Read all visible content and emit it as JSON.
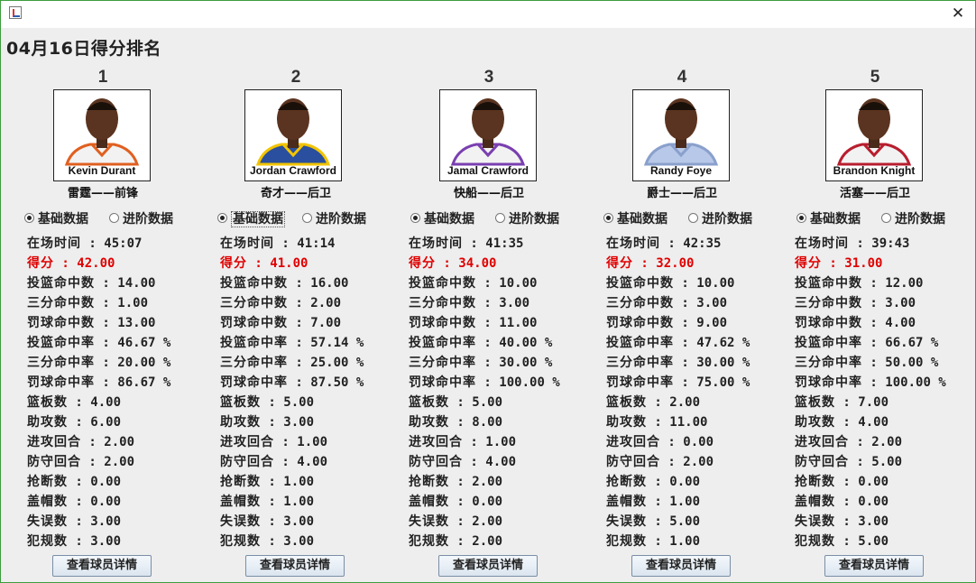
{
  "window": {
    "title": "",
    "close_glyph": "✕",
    "icon": "java-app-icon"
  },
  "page_title": "04月16日得分排名",
  "radio_labels": {
    "basic": "基础数据",
    "advanced": "进阶数据"
  },
  "detail_button_label": "查看球员详情",
  "colors": {
    "highlight": "#e00000",
    "background": "#eeeeee",
    "frame": "#3c9c3c"
  },
  "players": [
    {
      "rank": "1",
      "name": "Kevin Durant",
      "team_position": "雷霆——前锋",
      "jersey_color": "#f2f2f2",
      "trim_color": "#e06020",
      "stats": [
        {
          "label": "在场时间",
          "value": "45:07"
        },
        {
          "label": "得分",
          "value": "42.00"
        },
        {
          "label": "投篮命中数",
          "value": "14.00"
        },
        {
          "label": "三分命中数",
          "value": "1.00"
        },
        {
          "label": "罚球命中数",
          "value": "13.00"
        },
        {
          "label": "投篮命中率",
          "value": "46.67 %"
        },
        {
          "label": "三分命中率",
          "value": "20.00 %"
        },
        {
          "label": "罚球命中率",
          "value": "86.67 %"
        },
        {
          "label": "篮板数",
          "value": "4.00"
        },
        {
          "label": "助攻数",
          "value": "6.00"
        },
        {
          "label": "进攻回合",
          "value": "2.00"
        },
        {
          "label": "防守回合",
          "value": "2.00"
        },
        {
          "label": "抢断数",
          "value": "0.00"
        },
        {
          "label": "盖帽数",
          "value": "0.00"
        },
        {
          "label": "失误数",
          "value": "3.00"
        },
        {
          "label": "犯规数",
          "value": "3.00"
        }
      ]
    },
    {
      "rank": "2",
      "name": "Jordan Crawford",
      "team_position": "奇才——后卫",
      "jersey_color": "#2a4f9e",
      "trim_color": "#f2c400",
      "stats": [
        {
          "label": "在场时间",
          "value": "41:14"
        },
        {
          "label": "得分",
          "value": "41.00"
        },
        {
          "label": "投篮命中数",
          "value": "16.00"
        },
        {
          "label": "三分命中数",
          "value": "2.00"
        },
        {
          "label": "罚球命中数",
          "value": "7.00"
        },
        {
          "label": "投篮命中率",
          "value": "57.14 %"
        },
        {
          "label": "三分命中率",
          "value": "25.00 %"
        },
        {
          "label": "罚球命中率",
          "value": "87.50 %"
        },
        {
          "label": "篮板数",
          "value": "5.00"
        },
        {
          "label": "助攻数",
          "value": "3.00"
        },
        {
          "label": "进攻回合",
          "value": "1.00"
        },
        {
          "label": "防守回合",
          "value": "4.00"
        },
        {
          "label": "抢断数",
          "value": "1.00"
        },
        {
          "label": "盖帽数",
          "value": "1.00"
        },
        {
          "label": "失误数",
          "value": "3.00"
        },
        {
          "label": "犯规数",
          "value": "3.00"
        }
      ]
    },
    {
      "rank": "3",
      "name": "Jamal Crawford",
      "team_position": "快船——后卫",
      "jersey_color": "#f2f2f2",
      "trim_color": "#7a3fb0",
      "stats": [
        {
          "label": "在场时间",
          "value": "41:35"
        },
        {
          "label": "得分",
          "value": "34.00"
        },
        {
          "label": "投篮命中数",
          "value": "10.00"
        },
        {
          "label": "三分命中数",
          "value": "3.00"
        },
        {
          "label": "罚球命中数",
          "value": "11.00"
        },
        {
          "label": "投篮命中率",
          "value": "40.00 %"
        },
        {
          "label": "三分命中率",
          "value": "30.00 %"
        },
        {
          "label": "罚球命中率",
          "value": "100.00 %"
        },
        {
          "label": "篮板数",
          "value": "5.00"
        },
        {
          "label": "助攻数",
          "value": "8.00"
        },
        {
          "label": "进攻回合",
          "value": "1.00"
        },
        {
          "label": "防守回合",
          "value": "4.00"
        },
        {
          "label": "抢断数",
          "value": "2.00"
        },
        {
          "label": "盖帽数",
          "value": "0.00"
        },
        {
          "label": "失误数",
          "value": "2.00"
        },
        {
          "label": "犯规数",
          "value": "2.00"
        }
      ]
    },
    {
      "rank": "4",
      "name": "Randy Foye",
      "team_position": "爵士——后卫",
      "jersey_color": "#b8c8e8",
      "trim_color": "#8aa0cc",
      "stats": [
        {
          "label": "在场时间",
          "value": "42:35"
        },
        {
          "label": "得分",
          "value": "32.00"
        },
        {
          "label": "投篮命中数",
          "value": "10.00"
        },
        {
          "label": "三分命中数",
          "value": "3.00"
        },
        {
          "label": "罚球命中数",
          "value": "9.00"
        },
        {
          "label": "投篮命中率",
          "value": "47.62 %"
        },
        {
          "label": "三分命中率",
          "value": "30.00 %"
        },
        {
          "label": "罚球命中率",
          "value": "75.00 %"
        },
        {
          "label": "篮板数",
          "value": "2.00"
        },
        {
          "label": "助攻数",
          "value": "11.00"
        },
        {
          "label": "进攻回合",
          "value": "0.00"
        },
        {
          "label": "防守回合",
          "value": "2.00"
        },
        {
          "label": "抢断数",
          "value": "0.00"
        },
        {
          "label": "盖帽数",
          "value": "1.00"
        },
        {
          "label": "失误数",
          "value": "5.00"
        },
        {
          "label": "犯规数",
          "value": "1.00"
        }
      ]
    },
    {
      "rank": "5",
      "name": "Brandon Knight",
      "team_position": "活塞——后卫",
      "jersey_color": "#f2f2f2",
      "trim_color": "#b81e2e",
      "stats": [
        {
          "label": "在场时间",
          "value": "39:43"
        },
        {
          "label": "得分",
          "value": "31.00"
        },
        {
          "label": "投篮命中数",
          "value": "12.00"
        },
        {
          "label": "三分命中数",
          "value": "3.00"
        },
        {
          "label": "罚球命中数",
          "value": "4.00"
        },
        {
          "label": "投篮命中率",
          "value": "66.67 %"
        },
        {
          "label": "三分命中率",
          "value": "50.00 %"
        },
        {
          "label": "罚球命中率",
          "value": "100.00 %"
        },
        {
          "label": "篮板数",
          "value": "7.00"
        },
        {
          "label": "助攻数",
          "value": "4.00"
        },
        {
          "label": "进攻回合",
          "value": "2.00"
        },
        {
          "label": "防守回合",
          "value": "5.00"
        },
        {
          "label": "抢断数",
          "value": "0.00"
        },
        {
          "label": "盖帽数",
          "value": "0.00"
        },
        {
          "label": "失误数",
          "value": "3.00"
        },
        {
          "label": "犯规数",
          "value": "5.00"
        }
      ]
    }
  ]
}
